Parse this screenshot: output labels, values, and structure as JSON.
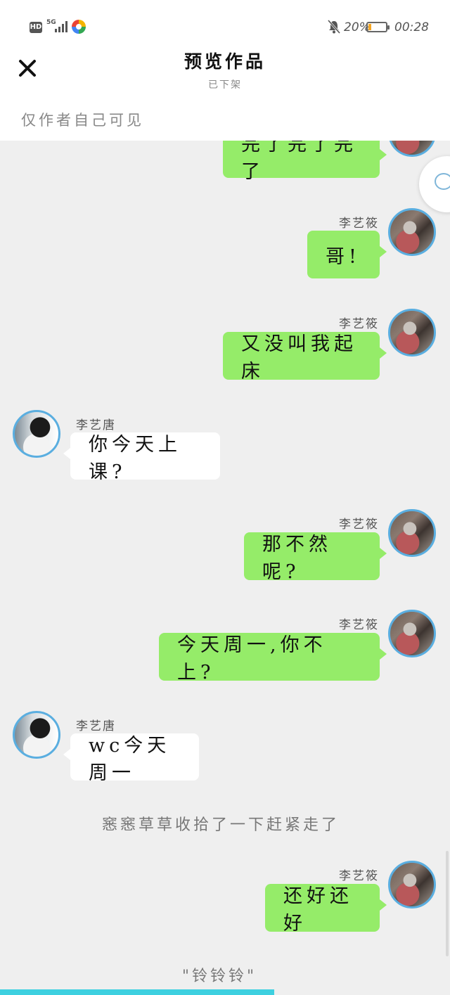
{
  "status_bar": {
    "hd": "HD",
    "network": "5G",
    "battery_percent": "20%",
    "battery_level": 0.2,
    "time": "00:28"
  },
  "header": {
    "title": "预览作品",
    "subtitle": "已下架",
    "visibility_note": "仅作者自己可见"
  },
  "messages": [
    {
      "side": "right",
      "name": "",
      "text": "完了完了完了"
    },
    {
      "side": "right",
      "name": "李艺筱",
      "text": "哥!"
    },
    {
      "side": "right",
      "name": "李艺筱",
      "text": "又没叫我起床"
    },
    {
      "side": "left",
      "name": "李艺唐",
      "text": "你今天上课?"
    },
    {
      "side": "right",
      "name": "李艺筱",
      "text": "那不然呢?"
    },
    {
      "side": "right",
      "name": "李艺筱",
      "text": "今天周一,你不上?"
    },
    {
      "side": "left",
      "name": "李艺唐",
      "text": "wc今天周一"
    },
    {
      "side": "narration",
      "text": "窸窸草草收拾了一下赶紧走了"
    },
    {
      "side": "right",
      "name": "李艺筱",
      "text": "还好还好"
    },
    {
      "side": "narration",
      "text": "\"铃铃铃\""
    }
  ],
  "reading_progress": 0.61,
  "colors": {
    "my_bubble": "#95ec69",
    "their_bubble": "#ffffff",
    "avatar_ring": "#5aaee0",
    "progress": "#3ed0e0"
  },
  "icons": [
    "close-icon",
    "bell-muted-icon",
    "battery-icon",
    "chat-bubble-icon"
  ]
}
